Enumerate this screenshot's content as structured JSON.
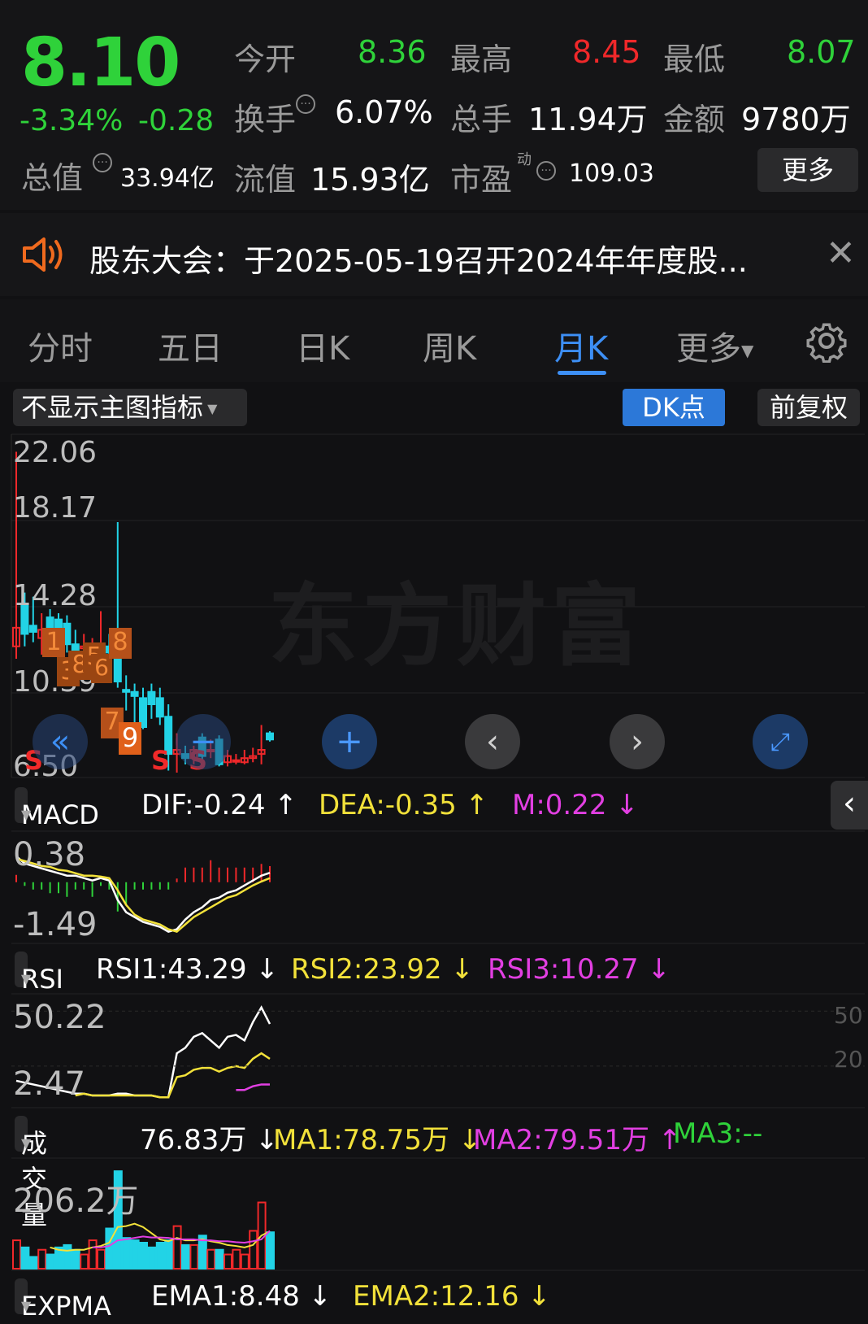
{
  "quote": {
    "price": "8.10",
    "change_pct": "-3.34%",
    "change_abs": "-0.28",
    "open_label": "今开",
    "open": "8.36",
    "high_label": "最高",
    "high": "8.45",
    "low_label": "最低",
    "low": "8.07",
    "turnover_label": "换手",
    "turnover": "6.07%",
    "volume_label": "总手",
    "volume": "11.94万",
    "amount_label": "金额",
    "amount": "9780万",
    "mktcap_label": "总值",
    "mktcap": "33.94亿",
    "float_label": "流值",
    "float": "15.93亿",
    "pe_label": "市盈",
    "pe_super": "动",
    "pe": "109.03",
    "more_label": "更多"
  },
  "notice": {
    "text": "股东大会：于2025-05-19召开2024年年度股..."
  },
  "tabs": [
    {
      "label": "分时"
    },
    {
      "label": "五日"
    },
    {
      "label": "日K"
    },
    {
      "label": "周K"
    },
    {
      "label": "月K",
      "active": true
    },
    {
      "label": "更多"
    }
  ],
  "toolbar": {
    "indicator_select": "不显示主图指标",
    "dk_label": "DK点",
    "adjust_label": "前复权"
  },
  "main_chart": {
    "y_labels": [
      "22.06",
      "18.17",
      "14.28",
      "10.39",
      "6.50"
    ],
    "watermark": "东方财富",
    "markers": [
      "1",
      "3",
      "8",
      "5",
      "6",
      "8",
      "7",
      "9",
      "S",
      "S",
      "S"
    ]
  },
  "macd": {
    "name": "MACD",
    "dif": "DIF:-0.24 ↑",
    "dea": "DEA:-0.35 ↑",
    "m": "M:0.22 ↓",
    "y_top": "0.38",
    "y_bottom": "-1.49"
  },
  "rsi": {
    "name": "RSI",
    "rsi1": "RSI1:43.29 ↓",
    "rsi2": "RSI2:23.92 ↓",
    "rsi3": "RSI3:10.27 ↓",
    "y_top": "50.22",
    "y_bottom": "2.47",
    "ref_50": "50",
    "ref_20": "20"
  },
  "volume": {
    "name": "成交量",
    "vol": "76.83万 ↓",
    "ma1": "MA1:78.75万 ↓",
    "ma2": "MA2:79.51万 ↑",
    "ma3": "MA3:--",
    "y_top": "206.2万"
  },
  "expma": {
    "name": "EXPMA",
    "ema1": "EMA1:8.48 ↓",
    "ema2": "EMA2:12.16 ↓"
  },
  "colors": {
    "up": "#f0282a",
    "down": "#22d3e6",
    "accent": "#3d8ff5",
    "green": "#2fd23a",
    "yellow": "#f2e13a",
    "magenta": "#e23fe2"
  },
  "chart_data": [
    {
      "type": "candlestick",
      "title": "",
      "ylim": [
        6.5,
        22.06
      ],
      "ticks": [
        22.06,
        18.17,
        14.28,
        10.39,
        6.5
      ],
      "candles": [
        [
          13.5,
          12.6,
          22.0,
          12.0,
          "up"
        ],
        [
          13.2,
          14.6,
          15.2,
          12.6,
          "down"
        ],
        [
          13.3,
          13.6,
          15.0,
          12.8,
          "down"
        ],
        [
          13.4,
          13.0,
          14.2,
          12.2,
          "up"
        ],
        [
          13.3,
          14.0,
          14.4,
          12.9,
          "down"
        ],
        [
          13.1,
          13.9,
          14.2,
          12.6,
          "down"
        ],
        [
          12.7,
          13.7,
          14.1,
          12.3,
          "down"
        ],
        [
          12.4,
          12.7,
          13.4,
          12.0,
          "down"
        ],
        [
          12.5,
          12.6,
          13.2,
          11.0,
          "up"
        ],
        [
          12.4,
          12.5,
          13.0,
          11.4,
          "up"
        ],
        [
          12.6,
          12.5,
          14.3,
          11.8,
          "up"
        ],
        [
          12.3,
          12.6,
          13.2,
          12.0,
          "down"
        ],
        [
          10.9,
          12.0,
          18.6,
          10.6,
          "down"
        ],
        [
          10.4,
          10.5,
          11.2,
          9.5,
          "down"
        ],
        [
          10.2,
          10.4,
          10.8,
          8.9,
          "down"
        ],
        [
          8.7,
          10.1,
          10.6,
          8.6,
          "down"
        ],
        [
          9.8,
          10.4,
          10.8,
          9.1,
          "down"
        ],
        [
          9.2,
          10.1,
          10.6,
          8.8,
          "down"
        ],
        [
          7.4,
          9.2,
          9.8,
          6.6,
          "down"
        ],
        [
          7.6,
          7.4,
          8.4,
          6.5,
          "up"
        ],
        [
          7.2,
          7.4,
          7.8,
          6.9,
          "down"
        ],
        [
          7.6,
          7.2,
          7.8,
          6.9,
          "up"
        ],
        [
          7.3,
          8.2,
          8.4,
          7.1,
          "down"
        ],
        [
          7.6,
          7.6,
          8.1,
          7.2,
          "up"
        ],
        [
          6.9,
          8.1,
          8.3,
          6.8,
          "down"
        ],
        [
          7.0,
          7.3,
          7.6,
          6.8,
          "up"
        ],
        [
          7.1,
          7.1,
          7.4,
          6.9,
          "up"
        ],
        [
          7.2,
          7.0,
          7.6,
          6.9,
          "up"
        ],
        [
          7.3,
          7.2,
          7.7,
          7.0,
          "up"
        ],
        [
          7.6,
          7.4,
          8.8,
          6.9,
          "up"
        ],
        [
          8.1,
          8.4,
          8.5,
          8.0,
          "down"
        ]
      ]
    },
    {
      "type": "line+bar",
      "title": "MACD",
      "ylim": [
        -1.49,
        0.38
      ],
      "series": [
        {
          "name": "DIF",
          "values": [
            0.1,
            -0.05,
            -0.1,
            -0.15,
            -0.2,
            -0.25,
            -0.3,
            -0.3,
            -0.35,
            -0.4,
            -0.35,
            -0.4,
            -0.8,
            -1.05,
            -1.15,
            -1.25,
            -1.3,
            -1.35,
            -1.45,
            -1.4,
            -1.2,
            -1.05,
            -0.95,
            -0.8,
            -0.75,
            -0.65,
            -0.6,
            -0.5,
            -0.4,
            -0.3,
            -0.24
          ]
        },
        {
          "name": "DEA",
          "values": [
            0.05,
            0.0,
            -0.05,
            -0.1,
            -0.12,
            -0.18,
            -0.2,
            -0.25,
            -0.3,
            -0.3,
            -0.32,
            -0.35,
            -0.6,
            -0.9,
            -1.1,
            -1.2,
            -1.25,
            -1.3,
            -1.4,
            -1.45,
            -1.3,
            -1.15,
            -1.05,
            -0.95,
            -0.85,
            -0.75,
            -0.7,
            -0.6,
            -0.5,
            -0.42,
            -0.35
          ]
        },
        {
          "name": "M",
          "values": [
            0.1,
            -0.05,
            -0.1,
            -0.1,
            -0.15,
            -0.15,
            -0.2,
            -0.1,
            -0.1,
            -0.2,
            -0.05,
            -0.1,
            -0.4,
            -0.3,
            -0.1,
            -0.1,
            -0.1,
            -0.1,
            -0.1,
            0.05,
            0.2,
            0.2,
            0.2,
            0.3,
            0.2,
            0.2,
            0.2,
            0.2,
            0.2,
            0.25,
            0.22
          ]
        }
      ]
    },
    {
      "type": "line",
      "title": "RSI",
      "ylim": [
        2.47,
        50.22
      ],
      "series": [
        {
          "name": "RSI1",
          "values": [
            12,
            11,
            10,
            9,
            8,
            7,
            6,
            5,
            5,
            4,
            4,
            4,
            5,
            5,
            4,
            4,
            4,
            3,
            3,
            27,
            30,
            36,
            38,
            34,
            30,
            36,
            37,
            34,
            44,
            52,
            43
          ]
        },
        {
          "name": "RSI2",
          "values": [
            null,
            null,
            null,
            null,
            null,
            null,
            null,
            4,
            5,
            4,
            4,
            4,
            4,
            4,
            4,
            4,
            4,
            3,
            3,
            14,
            15,
            18,
            19,
            19,
            17,
            19,
            20,
            19,
            24,
            27,
            24
          ]
        },
        {
          "name": "RSI3",
          "values": [
            null,
            null,
            null,
            null,
            null,
            null,
            null,
            null,
            null,
            null,
            null,
            null,
            null,
            null,
            null,
            null,
            null,
            null,
            null,
            null,
            null,
            null,
            null,
            null,
            null,
            null,
            7,
            7,
            9,
            10,
            10
          ]
        }
      ]
    },
    {
      "type": "bar+line",
      "title": "成交量",
      "ylim": [
        0,
        206.2
      ],
      "series": [
        {
          "name": "VOL",
          "values": [
            60,
            45,
            25,
            40,
            30,
            45,
            50,
            40,
            30,
            60,
            40,
            85,
            206,
            65,
            60,
            55,
            45,
            55,
            60,
            90,
            50,
            50,
            70,
            40,
            40,
            30,
            40,
            30,
            80,
            140,
            77
          ]
        },
        {
          "name": "MA1",
          "values": [
            null,
            null,
            null,
            null,
            45,
            40,
            38,
            40,
            40,
            45,
            48,
            55,
            88,
            90,
            95,
            88,
            75,
            62,
            58,
            65,
            60,
            60,
            62,
            58,
            55,
            50,
            48,
            45,
            50,
            70,
            79
          ]
        },
        {
          "name": "MA2",
          "values": [
            null,
            null,
            null,
            null,
            null,
            null,
            null,
            null,
            null,
            45,
            45,
            48,
            60,
            62,
            65,
            68,
            66,
            66,
            65,
            62,
            62,
            62,
            60,
            60,
            58,
            58,
            56,
            55,
            58,
            62,
            80
          ]
        }
      ]
    }
  ]
}
